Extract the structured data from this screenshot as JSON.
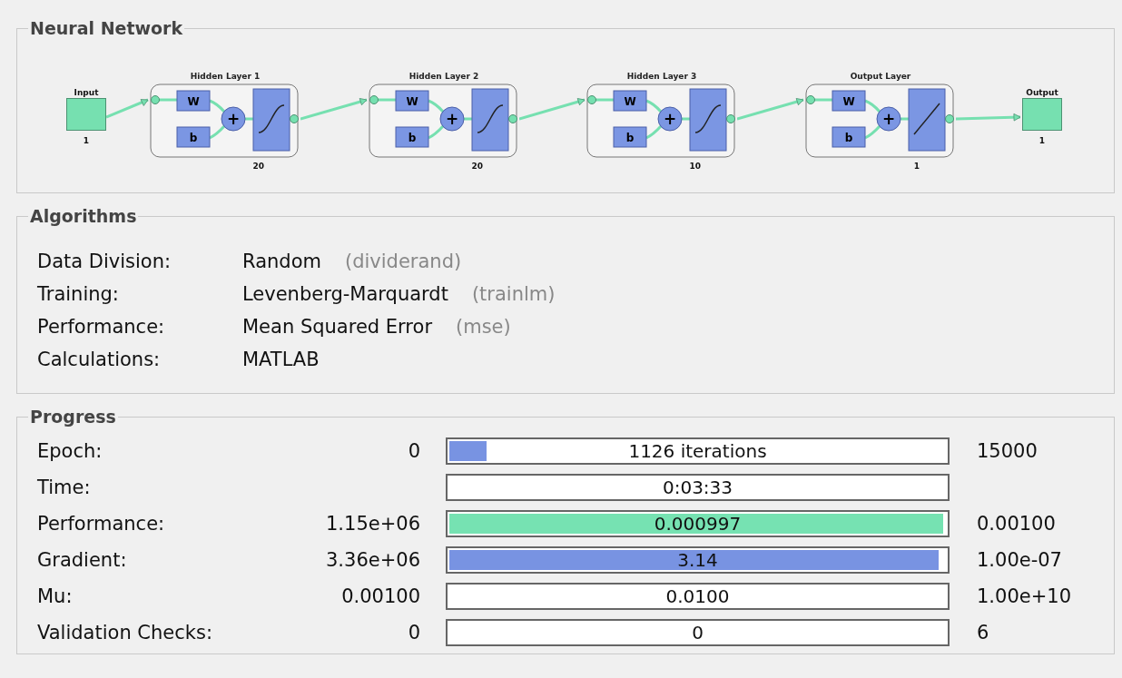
{
  "network": {
    "title": "Neural Network",
    "input": {
      "label": "Input",
      "size": "1"
    },
    "layers": [
      {
        "title": "Hidden Layer 1",
        "weight": "W",
        "bias": "b",
        "sum": "+",
        "kind": "sigmoid",
        "size": "20"
      },
      {
        "title": "Hidden Layer 2",
        "weight": "W",
        "bias": "b",
        "sum": "+",
        "kind": "sigmoid",
        "size": "20"
      },
      {
        "title": "Hidden Layer 3",
        "weight": "W",
        "bias": "b",
        "sum": "+",
        "kind": "sigmoid",
        "size": "10"
      },
      {
        "title": "Output Layer",
        "weight": "W",
        "bias": "b",
        "sum": "+",
        "kind": "linear",
        "size": "1"
      }
    ],
    "output": {
      "label": "Output",
      "size": "1"
    }
  },
  "algorithms": {
    "title": "Algorithms",
    "rows": [
      {
        "label": "Data Division:",
        "value": "Random",
        "function": "(dividerand)"
      },
      {
        "label": "Training:",
        "value": "Levenberg-Marquardt",
        "function": "(trainlm)"
      },
      {
        "label": "Performance:",
        "value": "Mean Squared Error",
        "function": "(mse)"
      },
      {
        "label": "Calculations:",
        "value": "MATLAB"
      }
    ]
  },
  "progress": {
    "title": "Progress",
    "rows": [
      {
        "label": "Epoch:",
        "min": "0",
        "reading": "1126 iterations",
        "max": "15000",
        "level": 0.075,
        "color": "#7893e2"
      },
      {
        "label": "Time:",
        "reading": "0:03:33"
      },
      {
        "label": "Performance:",
        "min": "1.15e+06",
        "reading": "0.000997",
        "max": "0.00100",
        "level": 0.995,
        "color": "#76e2b2"
      },
      {
        "label": "Gradient:",
        "min": "3.36e+06",
        "reading": "3.14",
        "max": "1.00e-07",
        "level": 0.985,
        "color": "#7893e2"
      },
      {
        "label": "Mu:",
        "min": "0.00100",
        "reading": "0.0100",
        "max": "1.00e+10"
      },
      {
        "label": "Validation Checks:",
        "min": "0",
        "reading": "0",
        "max": "6"
      }
    ]
  }
}
